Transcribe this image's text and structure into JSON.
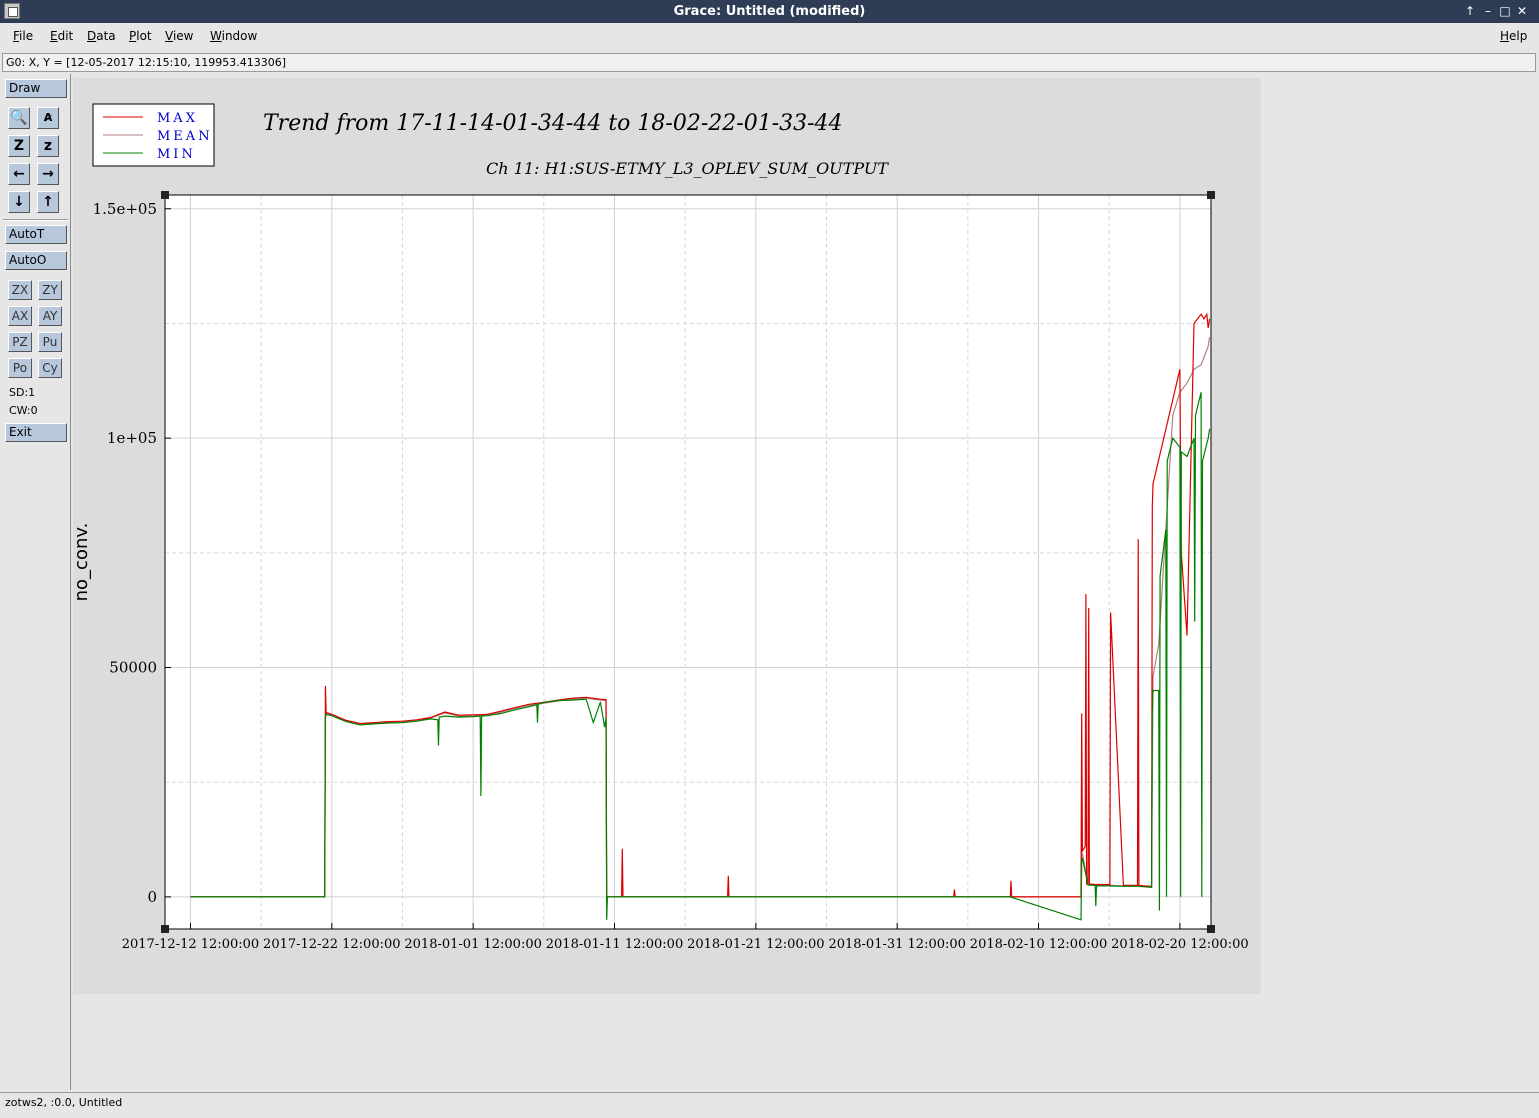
{
  "window": {
    "title": "Grace: Untitled (modified)",
    "controls": [
      "↑",
      "–",
      "□",
      "✕"
    ]
  },
  "menubar": {
    "items": [
      "File",
      "Edit",
      "Data",
      "Plot",
      "View",
      "Window"
    ],
    "help": "Help"
  },
  "locator": "G0: X, Y = [12-05-2017 12:15:10, 119953.413306]",
  "toolbar": {
    "draw": "Draw",
    "autot": "AutoT",
    "autoo": "AutoO",
    "zx": "ZX",
    "zy": "ZY",
    "ax": "AX",
    "ay": "AY",
    "pz": "PZ",
    "pu": "Pu",
    "po": "Po",
    "cy": "Cy",
    "sd": "SD:1",
    "cw": "CW:0",
    "exit": "Exit",
    "icons": {
      "zoom": "🔍",
      "text": "A̷",
      "zoom_in": "Z",
      "zoom_out": "z",
      "left": "←",
      "right": "→",
      "down": "↓",
      "up": "↑"
    }
  },
  "status": "zotws2, :0.0, Untitled",
  "colors": {
    "max": "#dd0000",
    "mean": "#b08080",
    "min": "#008000",
    "legend_text": "#0000cc"
  },
  "chart_data": {
    "type": "line",
    "title": "Trend from 17-11-14-01-34-44 to 18-02-22-01-33-44",
    "subtitle": "Ch 11: H1:SUS-ETMY_L3_OPLEV_SUM_OUTPUT",
    "xlabel": "",
    "ylabel": "no_conv.",
    "x_unit": "days since 2017-12-12 12:00:00",
    "xlim": [
      -1.8,
      72.2
    ],
    "ylim": [
      -7000,
      153000
    ],
    "x_ticks": [
      0,
      10,
      20,
      30,
      40,
      50,
      60,
      70
    ],
    "x_tick_labels": [
      "2017-12-12 12:00:00",
      "2017-12-22 12:00:00",
      "2018-01-01 12:00:00",
      "2018-01-11 12:00:00",
      "2018-01-21 12:00:00",
      "2018-01-31 12:00:00",
      "2018-02-10 12:00:00",
      "2018-02-20 12:00:00"
    ],
    "y_ticks": [
      0,
      50000,
      100000,
      150000
    ],
    "y_tick_labels": [
      "0",
      "50000",
      "1e+05",
      "1.5e+05"
    ],
    "legend": [
      "MAX",
      "MEAN",
      "MIN"
    ],
    "legend_position": "top-left",
    "grid": true,
    "series": [
      {
        "name": "MAX",
        "color": "#dd0000",
        "x": [
          0,
          9.5,
          9.55,
          9.6,
          9.7,
          10,
          11,
          12,
          13,
          14,
          15,
          16,
          17,
          18,
          19,
          20,
          21,
          22,
          23,
          24,
          25,
          26,
          27,
          28,
          29,
          29.4,
          29.45,
          29.5,
          30.5,
          30.55,
          30.6,
          30.7,
          38,
          38.05,
          38.1,
          54,
          54.05,
          54.1,
          58,
          58.05,
          58.1,
          63,
          63.05,
          63.1,
          63.3,
          63.35,
          63.4,
          63.5,
          63.55,
          63.6,
          64,
          65,
          65.05,
          65.1,
          66,
          67,
          67.05,
          67.1,
          67.5,
          68,
          68.05,
          68.1,
          70,
          70.05,
          70.1,
          70.5,
          71,
          71.5,
          71.7,
          71.9,
          72.0,
          72.1
        ],
        "y": [
          0,
          0,
          46000,
          40200,
          40100,
          39800,
          38500,
          37800,
          38000,
          38200,
          38300,
          38600,
          39100,
          40300,
          39600,
          39700,
          39800,
          40500,
          41300,
          42000,
          42400,
          42900,
          43300,
          43500,
          43100,
          43000,
          0,
          0,
          0,
          10500,
          0,
          0,
          0,
          4600,
          0,
          0,
          1600,
          0,
          0,
          3500,
          0,
          0,
          40000,
          10000,
          11000,
          66000,
          2800,
          2800,
          63000,
          2800,
          2700,
          2700,
          2500,
          62000,
          2500,
          2500,
          78000,
          2500,
          2400,
          2300,
          85000,
          90000,
          115000,
          92000,
          75000,
          57000,
          125000,
          127000,
          126000,
          127000,
          124000,
          126000
        ]
      },
      {
        "name": "MEAN",
        "color": "#b08080",
        "x": [
          0,
          9.5,
          9.55,
          9.6,
          9.7,
          10,
          11,
          12,
          13,
          14,
          15,
          16,
          17,
          18,
          19,
          20,
          21,
          22,
          23,
          24,
          25,
          26,
          27,
          28,
          29,
          29.4,
          29.45,
          29.5,
          30.5,
          38,
          54,
          55,
          58,
          63,
          63.05,
          63.1,
          63.5,
          64,
          65,
          66,
          67,
          67.5,
          68,
          68.1,
          68.5,
          69,
          69.5,
          70,
          70.5,
          71,
          71.5,
          72,
          72.1
        ],
        "y": [
          0,
          0,
          39500,
          40000,
          39900,
          39700,
          38400,
          37700,
          37900,
          38100,
          38200,
          38500,
          39000,
          40100,
          39400,
          39500,
          39600,
          40300,
          41100,
          41800,
          42200,
          42700,
          43100,
          43300,
          42900,
          42800,
          0,
          0,
          0,
          0,
          0,
          0,
          0,
          0,
          9000,
          9500,
          2700,
          2600,
          2500,
          2400,
          2400,
          2300,
          2300,
          48000,
          55000,
          80000,
          105000,
          110000,
          112000,
          115000,
          116000,
          120000,
          122000
        ]
      },
      {
        "name": "MIN",
        "color": "#008000",
        "x": [
          0,
          9.5,
          9.55,
          9.6,
          9.7,
          10,
          11,
          12,
          13,
          14,
          15,
          16,
          17,
          17.5,
          17.55,
          17.6,
          18,
          19,
          20,
          20.5,
          20.55,
          20.6,
          21,
          22,
          23,
          24,
          24.5,
          24.55,
          24.6,
          25,
          26,
          27,
          28,
          28.5,
          29,
          29.3,
          29.4,
          29.45,
          29.5,
          30.5,
          38,
          54,
          55,
          58,
          63,
          63.05,
          63.1,
          63.5,
          64,
          64.05,
          64.1,
          65,
          66,
          67,
          67.5,
          68,
          68.05,
          68.1,
          68.5,
          68.55,
          68.6,
          69,
          69.05,
          69.1,
          69.5,
          70,
          70.05,
          70.1,
          70.5,
          71,
          71.05,
          71.1,
          71.5,
          71.55,
          71.6,
          72,
          72.1
        ],
        "y": [
          0,
          0,
          39000,
          39800,
          39700,
          39500,
          38200,
          37500,
          37700,
          37900,
          38000,
          38300,
          38800,
          38600,
          33000,
          39200,
          39400,
          39200,
          39300,
          39400,
          22000,
          39400,
          39500,
          40000,
          40800,
          41500,
          41900,
          38000,
          42000,
          42400,
          42800,
          42900,
          43100,
          38000,
          42500,
          37000,
          39000,
          -5000,
          0,
          0,
          0,
          0,
          0,
          0,
          -5000,
          8000,
          8500,
          2600,
          2500,
          -2000,
          2400,
          2400,
          2300,
          2300,
          2200,
          2100,
          40000,
          45000,
          45000,
          -3000,
          70000,
          80000,
          0,
          95000,
          100000,
          98000,
          0,
          97000,
          96000,
          100000,
          60000,
          105000,
          110000,
          0,
          95000,
          100000,
          102000
        ]
      }
    ]
  }
}
